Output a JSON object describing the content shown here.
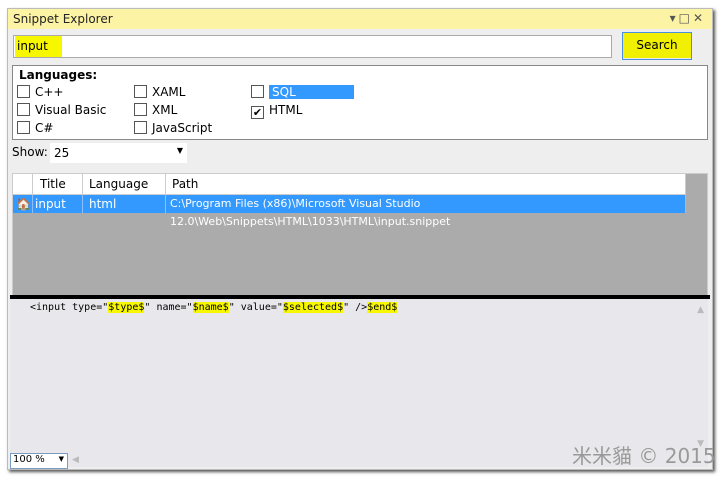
{
  "window": {
    "title": "Snippet Explorer"
  },
  "search": {
    "value": "input",
    "button": "Search"
  },
  "languages": {
    "heading": "Languages:",
    "items": [
      {
        "label": "C++",
        "checked": false
      },
      {
        "label": "Visual Basic",
        "checked": false
      },
      {
        "label": "C#",
        "checked": false
      },
      {
        "label": "XAML",
        "checked": false
      },
      {
        "label": "XML",
        "checked": false
      },
      {
        "label": "JavaScript",
        "checked": false
      },
      {
        "label": "SQL",
        "checked": false,
        "selected": true
      },
      {
        "label": "HTML",
        "checked": true
      }
    ]
  },
  "show": {
    "label": "Show:",
    "value": "25"
  },
  "grid": {
    "columns": [
      "Title",
      "Language",
      "Path"
    ],
    "rows": [
      {
        "title": "input",
        "language": "html",
        "path": "C:\\Program Files (x86)\\Microsoft Visual Studio 12.0\\Web\\Snippets\\HTML\\1033\\HTML\\input.snippet",
        "icon": "home-icon"
      }
    ]
  },
  "code": {
    "p1": "<input type=\"",
    "v1": "$type$",
    "p2": "\" name=\"",
    "v2": "$name$",
    "p3": "\" value=\"",
    "v3": "$selected$",
    "p4": "\" />",
    "v4": "$end$"
  },
  "zoom": {
    "value": "100 %"
  },
  "watermark": "米米貓 © 2015",
  "colors": {
    "title_bg": "#fdf3a4",
    "selection": "#3399ff",
    "highlight": "#f7f700"
  }
}
